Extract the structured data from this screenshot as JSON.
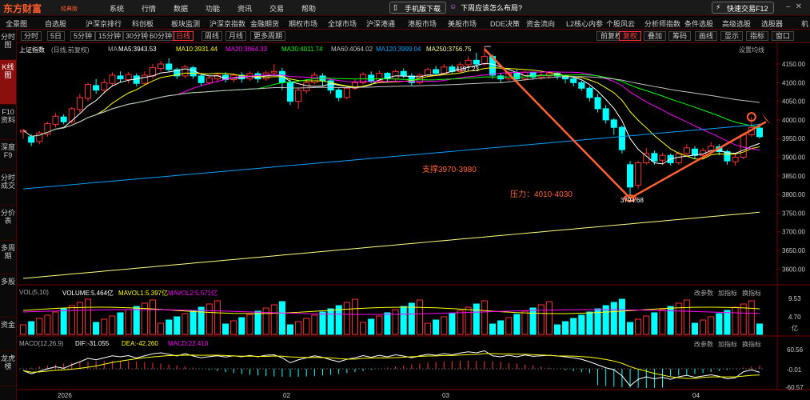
{
  "app": {
    "logo": "东方财富",
    "edition": "经典版",
    "menus": [
      "系统",
      "行情",
      "数据",
      "功能",
      "资讯",
      "交易",
      "帮助"
    ],
    "mobile_download": "手机版下载",
    "weekly_topic": "下周应该怎么布局?",
    "quick_trade": "快速交易F12"
  },
  "nav": [
    "全景图",
    "自选股",
    "沪深京排行",
    "科创板",
    "板块监测",
    "沪深京指数",
    "金融期货",
    "期权市场",
    "全球市场",
    "沪深港通",
    "港股市场",
    "美股市场",
    "DDE决策",
    "资金流向",
    "L2核心内参",
    "个股风云",
    "分析师指数",
    "条件选股",
    "高级选股",
    "选股器",
    "机"
  ],
  "sidebar": [
    "分时图",
    "K线图",
    "F10资料",
    "深度F9",
    "分时成交",
    "分价表",
    "多周期",
    "多股",
    "资金",
    "龙虎榜"
  ],
  "periods": [
    "分时",
    "5日",
    "5分钟",
    "15分钟",
    "30分钟",
    "60分钟",
    "日线",
    "周线",
    "月线",
    "更多周期"
  ],
  "active_period": "日线",
  "tools": [
    "前复权",
    "复权",
    "叠加",
    "筹码",
    "画线",
    "显示",
    "指标",
    "窗口"
  ],
  "chart": {
    "name": "上证指数",
    "mode": "(日线,前复权)",
    "settings": "设置均线",
    "indicator_tabs": [
      "改参数",
      "加指标",
      "换指标"
    ],
    "ma": [
      {
        "label": "MA5:3943.53",
        "color": "#ffffff"
      },
      {
        "label": "MA10:3931.44",
        "color": "#ffff00"
      },
      {
        "label": "MA20:3964.33",
        "color": "#ff00ff"
      },
      {
        "label": "MA30:4011.74",
        "color": "#00ff00"
      },
      {
        "label": "MA60:4064.02",
        "color": "#c0c0c0"
      },
      {
        "label": "MA120:3999.04",
        "color": "#00a0ff"
      },
      {
        "label": "MA250:3756.75",
        "color": "#ffff80"
      }
    ],
    "price_ticks": [
      "4150.00",
      "4100.00",
      "4050.00",
      "4000.00",
      "3950.00",
      "3900.00",
      "3850.00",
      "3800.00",
      "3750.00",
      "3700.00",
      "3650.00",
      "3600.00"
    ],
    "price_range": [
      3560,
      4180
    ],
    "high_label": "4197.23",
    "low_label": "3794.68",
    "annotations": [
      "支撑3970-3980",
      "压力：4010-4030"
    ],
    "accent": "#ff6030",
    "up_color": "#ff3030",
    "down_color": "#00ffff"
  },
  "volume": {
    "title": "VOL(5,10)",
    "volume": "VOLUME:5.464亿",
    "mavol1": "MAVOL1:5.397亿",
    "mavol2": "MAVOL2:5.571亿",
    "ticks": [
      "9.53",
      "4.70"
    ],
    "unit": "亿"
  },
  "macd": {
    "title": "MACD(12,26,9)",
    "dif": "DIF:-31.055",
    "dea": "DEA:-42.260",
    "macd": "MACD:22.410",
    "ticks": [
      "60.56",
      "-0.01",
      "-60.57"
    ]
  },
  "time_axis": [
    "2026",
    "02",
    "03",
    "04"
  ],
  "chart_data": {
    "type": "candlestick",
    "title": "上证指数",
    "ylim": [
      3560,
      4180
    ],
    "candles": [
      [
        3968,
        3972,
        3950,
        3975
      ],
      [
        3955,
        3940,
        3930,
        3962
      ],
      [
        3942,
        3965,
        3935,
        3970
      ],
      [
        3962,
        3990,
        3955,
        3995
      ],
      [
        3988,
        4010,
        3980,
        4018
      ],
      [
        4008,
        3995,
        3988,
        4015
      ],
      [
        3995,
        4030,
        3990,
        4035
      ],
      [
        4028,
        4060,
        4020,
        4070
      ],
      [
        4058,
        4095,
        4050,
        4100
      ],
      [
        4092,
        4080,
        4070,
        4110
      ],
      [
        4080,
        4100,
        4072,
        4110
      ],
      [
        4098,
        4120,
        4090,
        4128
      ],
      [
        4118,
        4110,
        4100,
        4130
      ],
      [
        4108,
        4122,
        4098,
        4128
      ],
      [
        4118,
        4098,
        4090,
        4125
      ],
      [
        4098,
        4120,
        4092,
        4130
      ],
      [
        4118,
        4140,
        4110,
        4150
      ],
      [
        4138,
        4150,
        4130,
        4158
      ],
      [
        4150,
        4135,
        4128,
        4165
      ],
      [
        4135,
        4118,
        4110,
        4140
      ],
      [
        4118,
        4142,
        4112,
        4148
      ],
      [
        4140,
        4118,
        4110,
        4145
      ],
      [
        4118,
        4100,
        4090,
        4122
      ],
      [
        4100,
        4112,
        4095,
        4118
      ],
      [
        4110,
        4120,
        4100,
        4125
      ],
      [
        4120,
        4108,
        4100,
        4128
      ],
      [
        4108,
        4120,
        4100,
        4125
      ],
      [
        4120,
        4110,
        4100,
        4128
      ],
      [
        4110,
        4124,
        4105,
        4130
      ],
      [
        4124,
        4110,
        4100,
        4130
      ],
      [
        4110,
        4126,
        4105,
        4132
      ],
      [
        4126,
        4130,
        4118,
        4150
      ],
      [
        4130,
        4100,
        4080,
        4140
      ],
      [
        4100,
        4050,
        4040,
        4110
      ],
      [
        4050,
        4080,
        4030,
        4085
      ],
      [
        4078,
        4100,
        4070,
        4110
      ],
      [
        4100,
        4120,
        4095,
        4128
      ],
      [
        4118,
        4105,
        4090,
        4125
      ],
      [
        4105,
        4080,
        4070,
        4110
      ],
      [
        4080,
        4060,
        4050,
        4085
      ],
      [
        4060,
        4085,
        4055,
        4090
      ],
      [
        4085,
        4100,
        4080,
        4110
      ],
      [
        4100,
        4122,
        4095,
        4128
      ],
      [
        4120,
        4105,
        4098,
        4130
      ],
      [
        4105,
        4125,
        4100,
        4132
      ],
      [
        4125,
        4110,
        4100,
        4128
      ],
      [
        4110,
        4130,
        4105,
        4135
      ],
      [
        4130,
        4118,
        4112,
        4138
      ],
      [
        4118,
        4100,
        4092,
        4125
      ],
      [
        4100,
        4120,
        4095,
        4125
      ],
      [
        4120,
        4135,
        4115,
        4140
      ],
      [
        4135,
        4125,
        4120,
        4145
      ],
      [
        4125,
        4142,
        4120,
        4150
      ],
      [
        4142,
        4130,
        4125,
        4148
      ],
      [
        4130,
        4148,
        4125,
        4155
      ],
      [
        4148,
        4160,
        4140,
        4170
      ],
      [
        4160,
        4150,
        4140,
        4180
      ],
      [
        4150,
        4170,
        4145,
        4197
      ],
      [
        4170,
        4120,
        4110,
        4175
      ],
      [
        4118,
        4110,
        4100,
        4125
      ],
      [
        4110,
        4125,
        4105,
        4130
      ],
      [
        4125,
        4110,
        4100,
        4135
      ],
      [
        4110,
        4128,
        4105,
        4132
      ],
      [
        4128,
        4115,
        4108,
        4130
      ],
      [
        4115,
        4120,
        4108,
        4128
      ],
      [
        4118,
        4125,
        4110,
        4130
      ],
      [
        4125,
        4118,
        4108,
        4128
      ],
      [
        4118,
        4110,
        4098,
        4122
      ],
      [
        4110,
        4100,
        4090,
        4115
      ],
      [
        4100,
        4085,
        4078,
        4105
      ],
      [
        4085,
        4060,
        4050,
        4090
      ],
      [
        4060,
        4030,
        4020,
        4070
      ],
      [
        4030,
        4000,
        3990,
        4040
      ],
      [
        4000,
        3980,
        3960,
        4005
      ],
      [
        3980,
        3920,
        3910,
        3985
      ],
      [
        3880,
        3820,
        3795,
        3890
      ],
      [
        3825,
        3885,
        3815,
        3890
      ],
      [
        3885,
        3910,
        3880,
        3925
      ],
      [
        3910,
        3890,
        3880,
        3918
      ],
      [
        3892,
        3905,
        3880,
        3912
      ],
      [
        3905,
        3885,
        3878,
        3910
      ],
      [
        3885,
        3910,
        3880,
        3915
      ],
      [
        3910,
        3925,
        3905,
        3935
      ],
      [
        3922,
        3905,
        3895,
        3930
      ],
      [
        3905,
        3918,
        3900,
        3925
      ],
      [
        3918,
        3930,
        3910,
        3940
      ],
      [
        3928,
        3915,
        3905,
        3935
      ],
      [
        3915,
        3890,
        3880,
        3920
      ],
      [
        3888,
        3900,
        3878,
        3910
      ],
      [
        3900,
        3960,
        3895,
        3965
      ],
      [
        3960,
        3980,
        3955,
        4008
      ],
      [
        3978,
        3955,
        3950,
        3990
      ]
    ]
  }
}
